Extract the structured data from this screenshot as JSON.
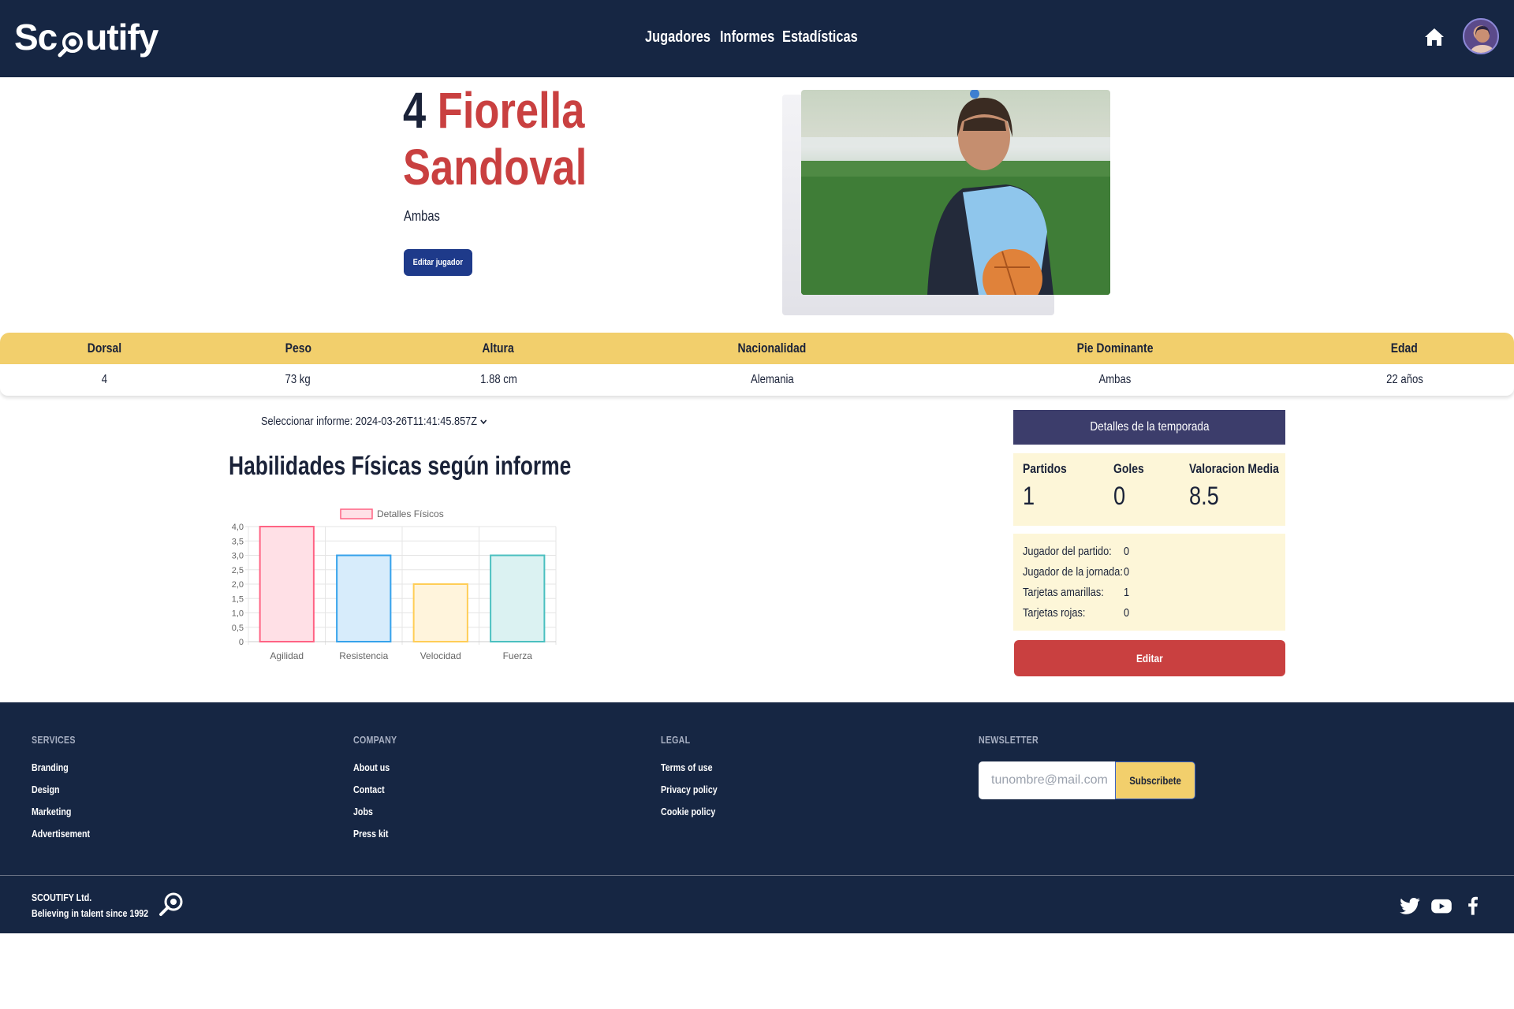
{
  "nav": {
    "logo": "Scoutify",
    "links": [
      "Jugadores",
      "Informes",
      "Estadísticas"
    ],
    "home_icon": "home-icon",
    "avatar": "user-avatar"
  },
  "player": {
    "number": "4",
    "first_name": "Fiorella",
    "last_name": "Sandoval",
    "foot": "Ambas",
    "edit_label": "Editar jugador"
  },
  "info": {
    "headers": [
      "Dorsal",
      "Peso",
      "Altura",
      "Nacionalidad",
      "Pie Dominante",
      "Edad"
    ],
    "values": [
      "4",
      "73 kg",
      "1.88 cm",
      "Alemania",
      "Ambas",
      "22 años"
    ]
  },
  "report": {
    "select_label": "Seleccionar informe: 2024-03-26T11:41:45.857Z",
    "chart_title": "Habilidades Físicas según informe"
  },
  "chart_data": {
    "type": "bar",
    "legend": "Detalles Físicos",
    "categories": [
      "Agilidad",
      "Resistencia",
      "Velocidad",
      "Fuerza"
    ],
    "values": [
      4,
      3,
      2,
      3
    ],
    "ylim": [
      0,
      4
    ],
    "yticks": [
      "0",
      "0,5",
      "1,0",
      "1,5",
      "2,0",
      "2,5",
      "3,0",
      "3,5",
      "4,0"
    ],
    "colors": {
      "fill": [
        "#ffe0e6",
        "#d7ecfb",
        "#fff4dc",
        "#dbf2f2"
      ],
      "stroke": [
        "#ff6384",
        "#36a2eb",
        "#ffcd56",
        "#4bc0c0"
      ]
    },
    "grid": true,
    "legend_position": "top"
  },
  "season": {
    "title": "Detalles de la temporada",
    "stats": [
      {
        "label": "Partidos",
        "value": "1"
      },
      {
        "label": "Goles",
        "value": "0"
      },
      {
        "label": "Valoracion Media",
        "value": "8.5"
      }
    ],
    "awards": [
      {
        "label": "Jugador del partido:",
        "value": "0"
      },
      {
        "label": "Jugador de la jornada:",
        "value": "0"
      },
      {
        "label": "Tarjetas amarillas:",
        "value": "1"
      },
      {
        "label": "Tarjetas rojas:",
        "value": "0"
      }
    ],
    "edit_label": "Editar"
  },
  "footer": {
    "services": {
      "title": "SERVICES",
      "links": [
        "Branding",
        "Design",
        "Marketing",
        "Advertisement"
      ]
    },
    "company": {
      "title": "COMPANY",
      "links": [
        "About us",
        "Contact",
        "Jobs",
        "Press kit"
      ]
    },
    "legal": {
      "title": "LEGAL",
      "links": [
        "Terms of use",
        "Privacy policy",
        "Cookie policy"
      ]
    },
    "newsletter": {
      "title": "NEWSLETTER",
      "placeholder": "tunombre@mail.com",
      "button": "Subscribete"
    },
    "company_name": "SCOUTIFY Ltd.",
    "tagline": "Believing in talent since 1992",
    "social": [
      "twitter-icon",
      "youtube-icon",
      "facebook-icon"
    ]
  },
  "colors": {
    "navy": "#162643",
    "accent_red": "#c94040",
    "gold": "#f2cf6c",
    "button_blue": "#1e3a8a",
    "season_header": "#3c3d6b",
    "season_bg": "#fdf6d8"
  }
}
